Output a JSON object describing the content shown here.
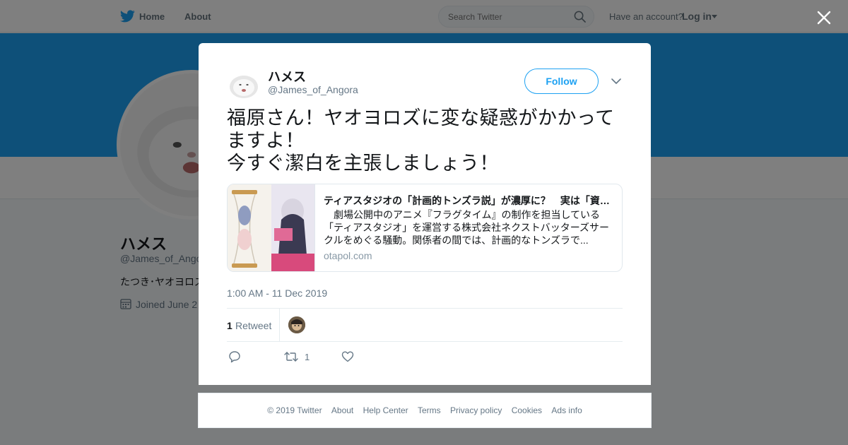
{
  "topbar": {
    "home_label": "Home",
    "about_label": "About",
    "search_placeholder": "Search Twitter",
    "have_account": "Have an account?",
    "login_label": "Log in"
  },
  "profile": {
    "name": "ハメス",
    "handle": "@James_of_Angora",
    "bio": "たつき･ヤオヨロズ",
    "joined": "Joined June 2"
  },
  "tweet": {
    "author_name": "ハメス",
    "author_handle": "@James_of_Angora",
    "follow_label": "Follow",
    "text": "福原さん！ヤオヨロズに変な疑惑がかかってますよ！\n今すぐ潔白を主張しましょう！",
    "card": {
      "title": "ティアスタジオの「計画的トンズラ説」が濃厚に？　実は「資…",
      "description": "　劇場公開中のアニメ『フラグタイム』の制作を担当している「ティアスタジオ」を運営する株式会社ネクストバッターズサークルをめぐる騒動。関係者の間では、計画的なトンズラで...",
      "domain": "otapol.com"
    },
    "timestamp": "1:00 AM - 11 Dec 2019",
    "retweet_count": "1",
    "retweet_label": "Retweet",
    "action_retweet_count": "1"
  },
  "footer": {
    "copyright": "© 2019 Twitter",
    "links": [
      "About",
      "Help Center",
      "Terms",
      "Privacy policy",
      "Cookies",
      "Ads info"
    ]
  },
  "colors": {
    "brand": "#1da1f2",
    "text": "#14171a",
    "secondary": "#657786"
  },
  "icons": [
    "twitter-bird-icon",
    "search-icon",
    "caret-down-icon",
    "close-icon",
    "chevron-down-icon",
    "reply-icon",
    "retweet-icon",
    "like-icon",
    "calendar-icon"
  ]
}
